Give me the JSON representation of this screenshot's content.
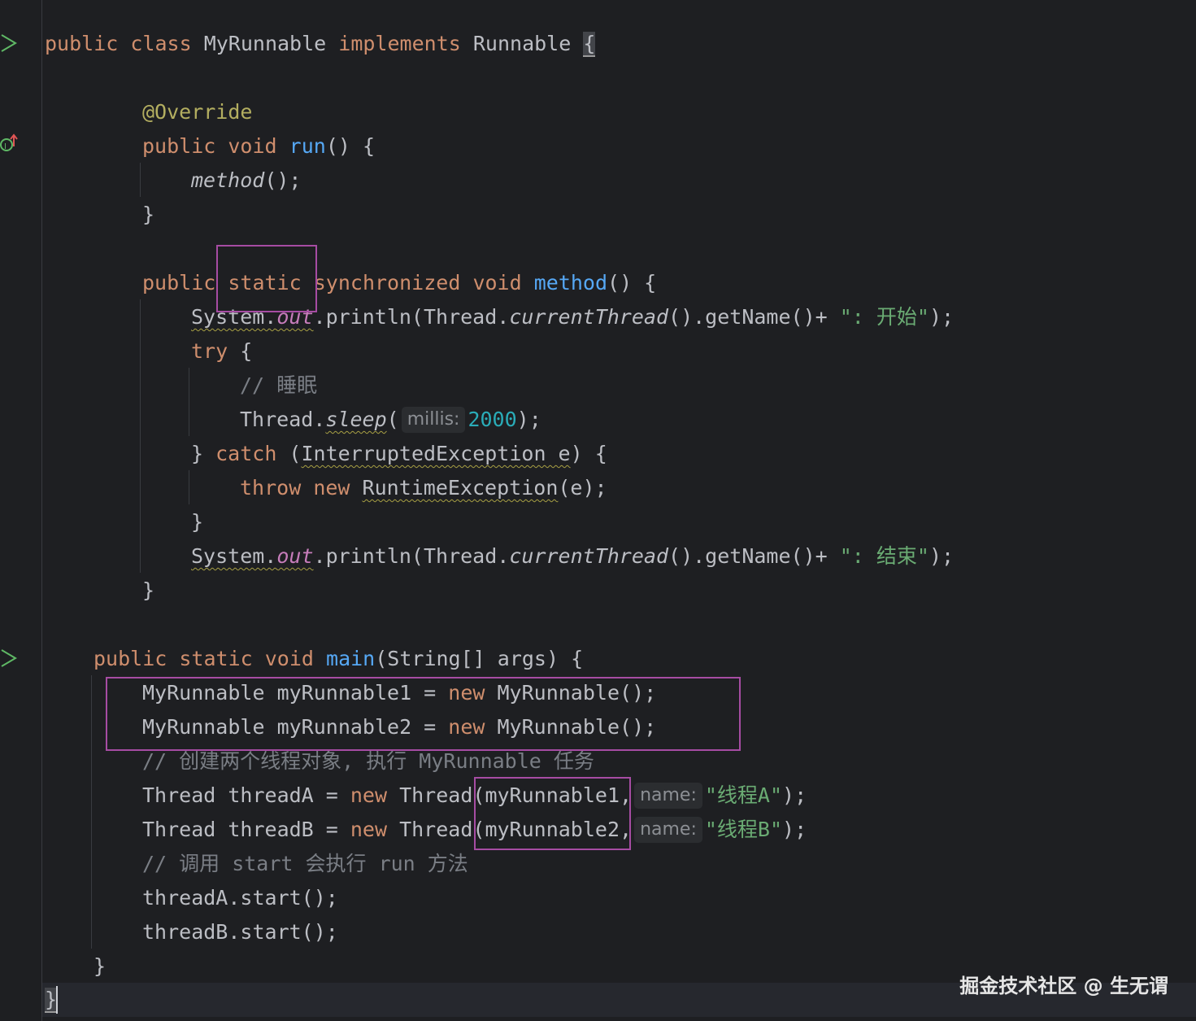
{
  "gutter": {
    "run_icons": [
      "run-class-icon",
      "run-main-icon"
    ],
    "impl_icon": "implements-override-icon"
  },
  "code": {
    "l1": {
      "kw1": "public",
      "kw2": "class",
      "name": "MyRunnable",
      "kw3": "implements",
      "iface": "Runnable",
      "brace": "{"
    },
    "l3": {
      "annotation": "@Override"
    },
    "l4": {
      "kw1": "public",
      "kw2": "void",
      "fn": "run",
      "rest": "() {"
    },
    "l5": {
      "call": "method",
      "rest": "();"
    },
    "l6": {
      "text": "}"
    },
    "l8": {
      "kw1": "public",
      "kw2": "static",
      "kw3": "synchronized",
      "kw4": "void",
      "fn": "method",
      "rest": "() {"
    },
    "l9": {
      "cls": "System.",
      "field": "out",
      "mid": ".println(Thread.",
      "static_call": "currentThread",
      "tail": "().getName()+ ",
      "str": "\": 开始\"",
      "end": ");"
    },
    "l10": {
      "kw": "try",
      "rest": " {"
    },
    "l11": {
      "comment": "// 睡眠"
    },
    "l12": {
      "cls": "Thread.",
      "call": "sleep",
      "open": "(",
      "hint": "millis:",
      "num": "2000",
      "end": ");"
    },
    "l13": {
      "open": "} ",
      "kw": "catch",
      "paren": " (",
      "type": "InterruptedException e",
      "rest": ") {"
    },
    "l14": {
      "kw1": "throw",
      "kw2": "new",
      "type": "RuntimeException",
      "rest": "(e);"
    },
    "l15": {
      "text": "}"
    },
    "l16": {
      "cls": "System.",
      "field": "out",
      "mid": ".println(Thread.",
      "static_call": "currentThread",
      "tail": "().getName()+ ",
      "str": "\": 结束\"",
      "end": ");"
    },
    "l17": {
      "text": "}"
    },
    "l19": {
      "kw1": "public",
      "kw2": "static",
      "kw3": "void",
      "fn": "main",
      "rest": "(String[] args) {"
    },
    "l20": {
      "pre": "MyRunnable myRunnable1 = ",
      "kw": "new",
      "post": " MyRunnable();"
    },
    "l21": {
      "pre": "MyRunnable myRunnable2 = ",
      "kw": "new",
      "post": " MyRunnable();"
    },
    "l22": {
      "comment": "// 创建两个线程对象, 执行 MyRunnable 任务"
    },
    "l23": {
      "pre": "Thread threadA = ",
      "kw": "new",
      "mid": " Thread(myRunnable1,",
      "hint": "name:",
      "str": "\"线程A\"",
      "end": ");"
    },
    "l24": {
      "pre": "Thread threadB = ",
      "kw": "new",
      "mid": " Thread(myRunnable2,",
      "hint": "name:",
      "str": "\"线程B\"",
      "end": ");"
    },
    "l25": {
      "comment": "// 调用 start 会执行 run 方法"
    },
    "l26": {
      "text": "threadA.start();"
    },
    "l27": {
      "text": "threadB.start();"
    },
    "l28": {
      "text": "}"
    },
    "l29": {
      "text": "}"
    }
  },
  "watermark": "掘金技术社区 @ 生无谓"
}
